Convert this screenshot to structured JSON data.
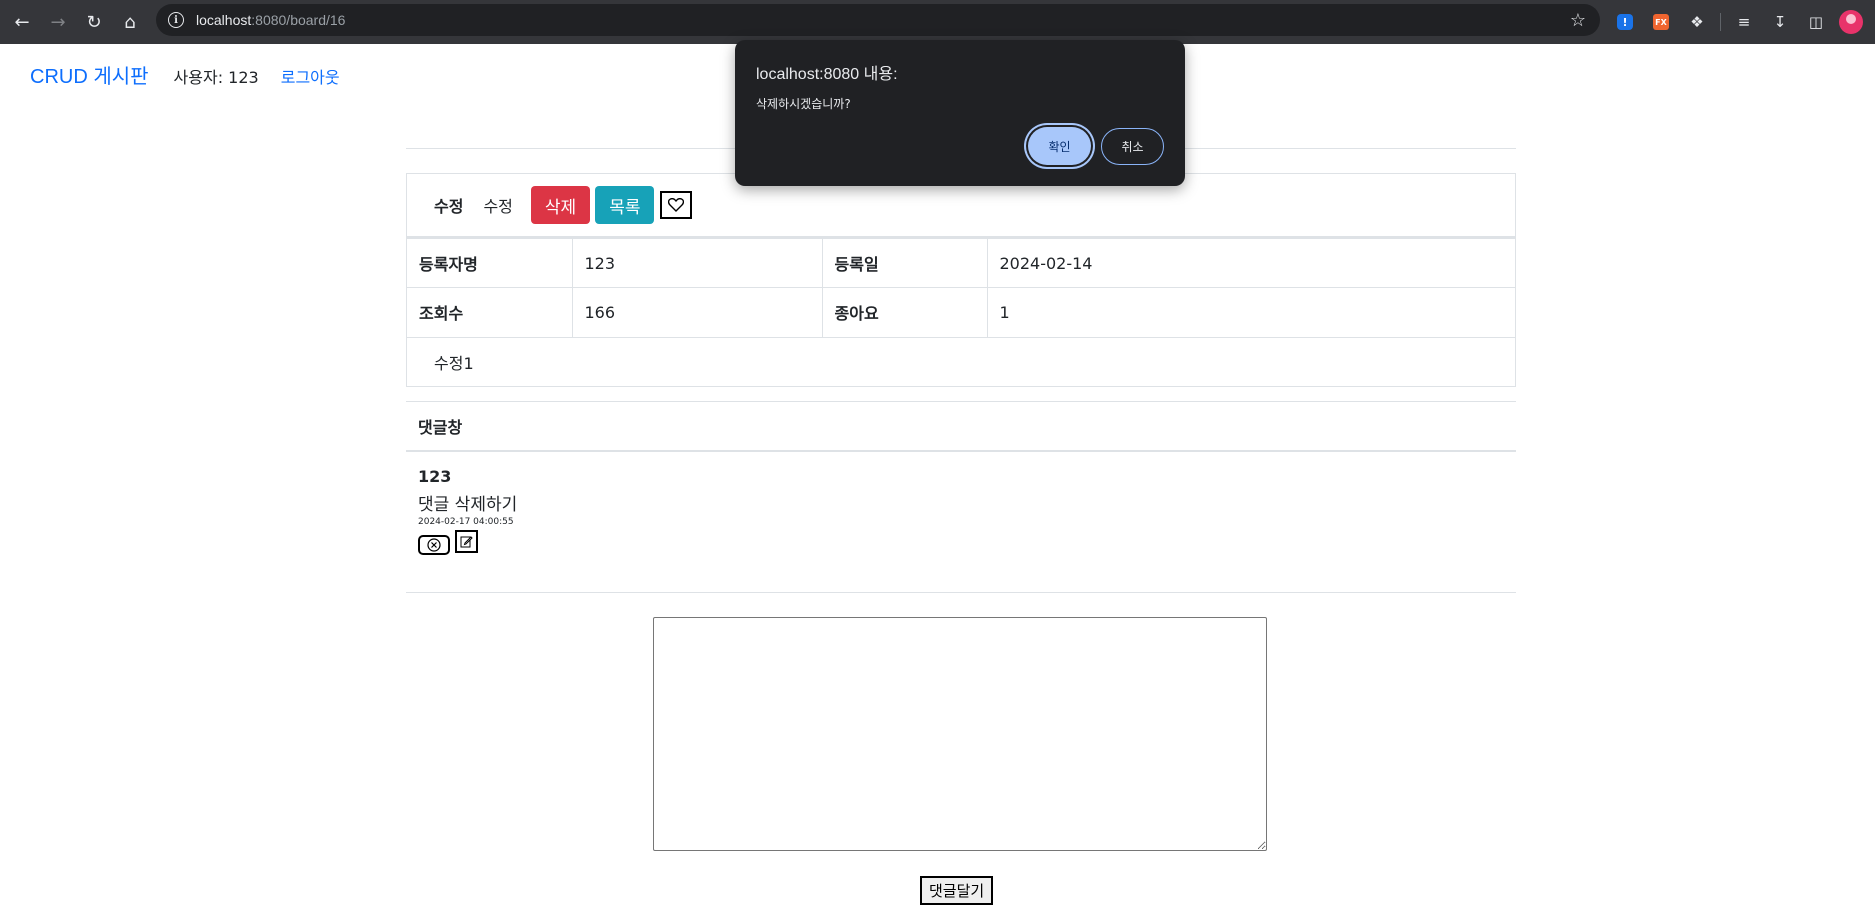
{
  "browser": {
    "url_host": "localhost",
    "url_rest": ":8080/board/16"
  },
  "header": {
    "brand": "CRUD 게시판",
    "user": "사용자: 123",
    "logout": "로그아웃"
  },
  "post": {
    "edit_label": "수정",
    "edit_link": "수정",
    "delete_button": "삭제",
    "list_button": "목록",
    "rows": [
      {
        "label1": "등록자명",
        "value1": "123",
        "label2": "등록일",
        "value2": "2024-02-14"
      },
      {
        "label1": "조회수",
        "value1": "166",
        "label2": "종아요",
        "value2": "1"
      }
    ],
    "content": "수정1"
  },
  "comments": {
    "title": "댓글창",
    "items": [
      {
        "author": "123",
        "text": "댓글 삭제하기",
        "date": "2024-02-17 04:00:55"
      }
    ],
    "submit": "댓글달기",
    "textarea_value": ""
  },
  "dialog": {
    "title": "localhost:8080 내용:",
    "message": "삭제하시겠습니까?",
    "ok": "확인",
    "cancel": "취소"
  },
  "colors": {
    "primary": "#0d6efd",
    "danger": "#dc3545",
    "info": "#17a2b8",
    "dialog_bg": "#202124",
    "dialog_ok": "#a8c7fa"
  }
}
